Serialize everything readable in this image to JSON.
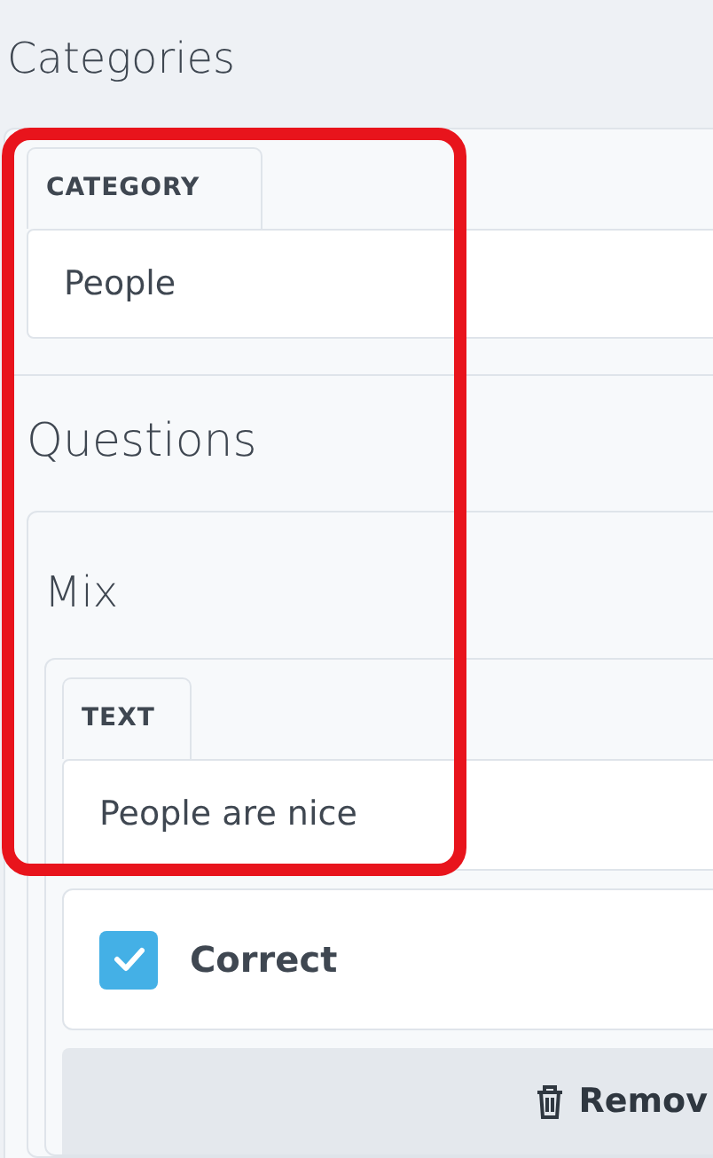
{
  "page_title": "Categories",
  "category": {
    "tab_label": "CATEGORY",
    "value": "People"
  },
  "questions": {
    "heading": "Questions",
    "items": [
      {
        "title": "Mix",
        "answers": [
          {
            "tab_label": "TEXT",
            "value": "People are nice",
            "correct_label": "Correct",
            "checked": true,
            "remove_label": "Remov"
          }
        ]
      }
    ]
  },
  "highlight": true
}
